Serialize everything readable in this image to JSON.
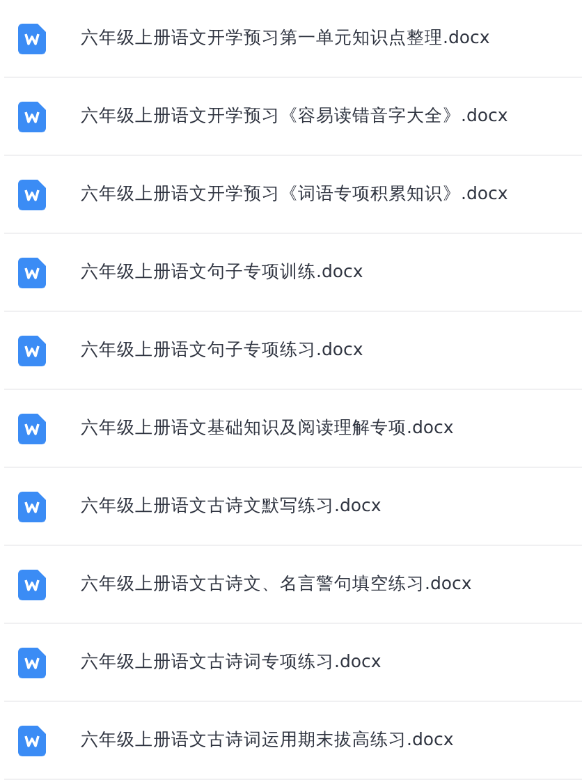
{
  "files": [
    {
      "name": "六年级上册语文开学预习第一单元知识点整理.docx"
    },
    {
      "name": "六年级上册语文开学预习《容易读错音字大全》.docx"
    },
    {
      "name": "六年级上册语文开学预习《词语专项积累知识》.docx"
    },
    {
      "name": "六年级上册语文句子专项训练.docx"
    },
    {
      "name": "六年级上册语文句子专项练习.docx"
    },
    {
      "name": "六年级上册语文基础知识及阅读理解专项.docx"
    },
    {
      "name": "六年级上册语文古诗文默写练习.docx"
    },
    {
      "name": "六年级上册语文古诗文、名言警句填空练习.docx"
    },
    {
      "name": "六年级上册语文古诗词专项练习.docx"
    },
    {
      "name": "六年级上册语文古诗词运用期末拔高练习.docx"
    }
  ]
}
